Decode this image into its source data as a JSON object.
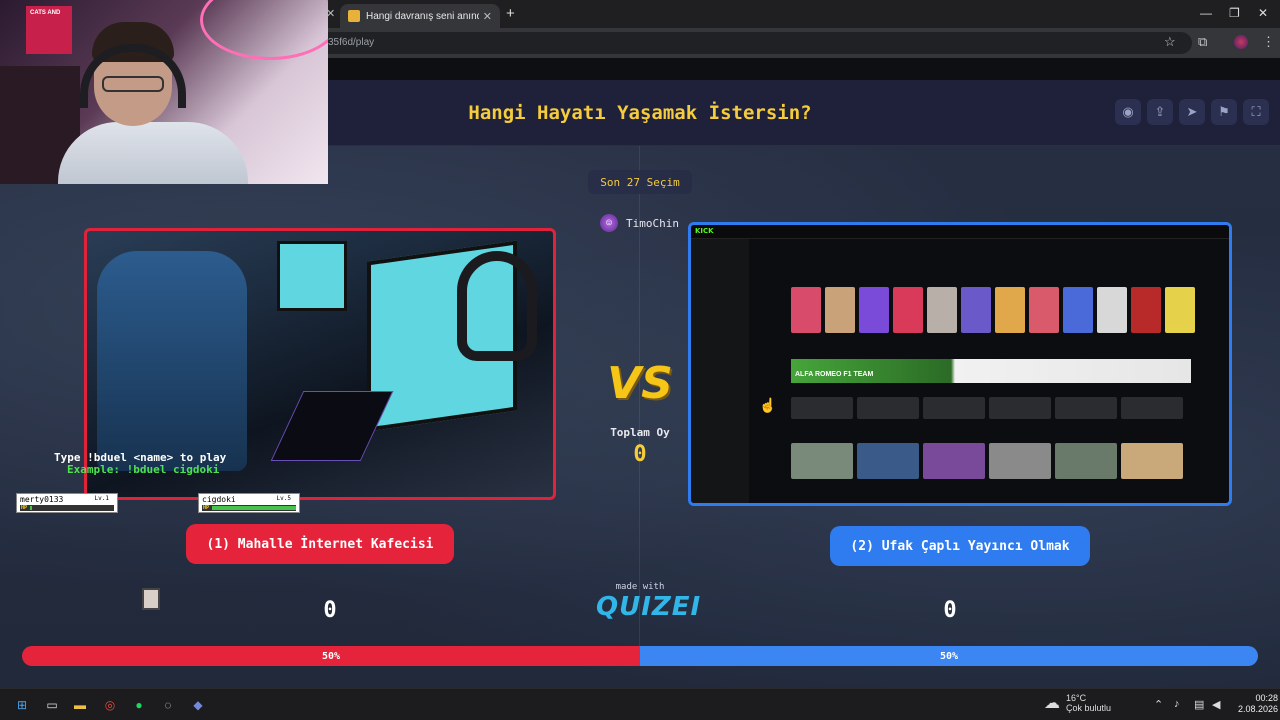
{
  "browser": {
    "tab_title": "Hangi davranış seni anında uza",
    "url": "35f6d/play"
  },
  "quiz": {
    "title": "Hangi Hayatı Yaşamak İstersin?",
    "recent_choices": "Son 27 Seçim",
    "chooser_name": "TimoChin",
    "vs_text": "VS",
    "total_votes_label": "Toplam Oy",
    "total_votes_value": "0",
    "option_left": "(1) Mahalle İnternet Kafecisi",
    "option_right": "(2) Ufak Çaplı Yayıncı Olmak",
    "score_left": "0",
    "score_right": "0",
    "percent_left": "50%",
    "percent_right": "50%",
    "percent_left_value": 50,
    "percent_right_value": 50,
    "made_with": "made with",
    "brand": "QUIZEI",
    "header_icons": [
      "eye-icon",
      "share-icon",
      "send-icon",
      "flag-icon",
      "fullscreen-icon"
    ]
  },
  "kick_preview": {
    "logo": "KICK",
    "banner_text": "ALFA ROMEO F1 TEAM",
    "banner_brand": "KICK"
  },
  "overlay": {
    "player1_name": "merty0133",
    "player1_level": "Lv.1",
    "player2_name": "cigdoki",
    "player2_level": "Lv.5",
    "hp_label": "HP",
    "duel_hint_line1": "Type !bduel <name> to play",
    "duel_hint_line2": "Example: !bduel cigdoki",
    "poster_text": "CATS AND"
  },
  "taskbar": {
    "weather_temp": "16°C",
    "weather_desc": "Çok bulutlu",
    "time": "00:28",
    "date": "2.08.2026"
  },
  "colors": {
    "accent_yellow": "#f5cc3c",
    "left_red": "#e5243b",
    "right_blue": "#2f7bf0"
  }
}
